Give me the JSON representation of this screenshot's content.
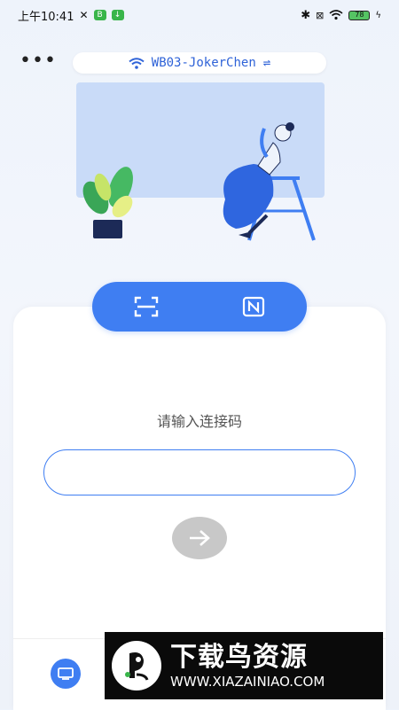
{
  "status_bar": {
    "time": "上午10:41",
    "battery": "78"
  },
  "topbar": {
    "more_label": "•••",
    "wifi_name": "WB03-JokerChen",
    "switch_icon": "⇌"
  },
  "connect": {
    "prompt": "请输入连接码",
    "code_value": "",
    "code_placeholder": ""
  },
  "colors": {
    "accent": "#3f7ef2",
    "disabled": "#c8c8c8"
  },
  "icons": {
    "scan": "scan-icon",
    "nfc": "nfc-icon",
    "submit": "arrow-right-icon",
    "device": "device-icon"
  },
  "watermark": {
    "title": "下载鸟资源",
    "url": "WWW.XIAZAINIAO.COM"
  }
}
